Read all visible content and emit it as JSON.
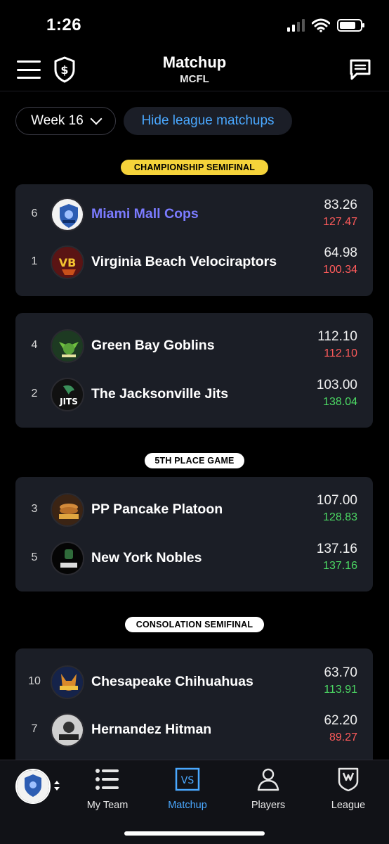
{
  "status_bar": {
    "time": "1:26"
  },
  "header": {
    "title": "Matchup",
    "subtitle": "MCFL"
  },
  "filters": {
    "week_label": "Week 16",
    "hide_label": "Hide league matchups"
  },
  "sections": {
    "championship": "CHAMPIONSHIP SEMIFINAL",
    "fifth": "5TH PLACE GAME",
    "consolation": "CONSOLATION SEMIFINAL"
  },
  "matchups": [
    {
      "teams": [
        {
          "seed": "6",
          "name": "Miami Mall Cops",
          "score": "83.26",
          "projected": "127.47",
          "proj_color": "red",
          "mine": true
        },
        {
          "seed": "1",
          "name": "Virginia Beach Velociraptors",
          "score": "64.98",
          "projected": "100.34",
          "proj_color": "red"
        }
      ]
    },
    {
      "teams": [
        {
          "seed": "4",
          "name": "Green Bay Goblins",
          "score": "112.10",
          "projected": "112.10",
          "proj_color": "red"
        },
        {
          "seed": "2",
          "name": "The Jacksonville Jits",
          "score": "103.00",
          "projected": "138.04",
          "proj_color": "green"
        }
      ]
    },
    {
      "teams": [
        {
          "seed": "3",
          "name": "PP Pancake Platoon",
          "score": "107.00",
          "projected": "128.83",
          "proj_color": "green"
        },
        {
          "seed": "5",
          "name": "New York Nobles",
          "score": "137.16",
          "projected": "137.16",
          "proj_color": "green"
        }
      ]
    },
    {
      "teams": [
        {
          "seed": "10",
          "name": "Chesapeake Chihuahuas",
          "score": "63.70",
          "projected": "113.91",
          "proj_color": "green"
        },
        {
          "seed": "7",
          "name": "Hernandez Hitman",
          "score": "62.20",
          "projected": "89.27",
          "proj_color": "red"
        }
      ]
    }
  ],
  "tabbar": {
    "my_team": "My Team",
    "matchup": "Matchup",
    "players": "Players",
    "league": "League"
  },
  "colors": {
    "accent": "#4aa8ff",
    "my_team_name": "#7b7bff",
    "projected_red": "#ff5b5b",
    "projected_green": "#4cd964",
    "championship_label": "#f5d33a"
  }
}
